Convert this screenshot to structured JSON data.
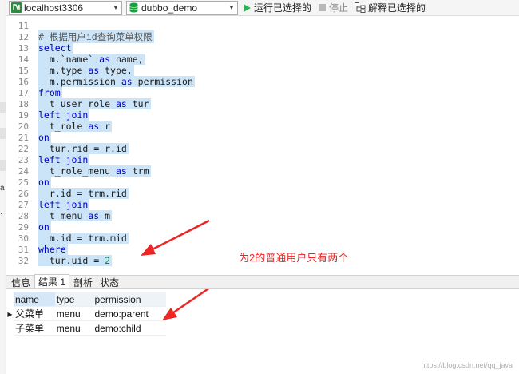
{
  "toolbar": {
    "connection": "localhost3306",
    "database": "dubbo_demo",
    "run_selected": "运行已选择的",
    "stop": "停止",
    "explain_selected": "解释已选择的"
  },
  "left_sliver": {
    "glyph_a": "a",
    "glyph_b": "·"
  },
  "editor": {
    "lines": [
      {
        "n": "11",
        "segs": []
      },
      {
        "n": "12",
        "segs": [
          {
            "t": "# 根据用户id查询菜单权限",
            "c": "cm"
          }
        ]
      },
      {
        "n": "13",
        "segs": [
          {
            "t": "select",
            "c": "kw"
          }
        ]
      },
      {
        "n": "14",
        "segs": [
          {
            "t": "  m.`name` ",
            "c": ""
          },
          {
            "t": "as",
            "c": "kw"
          },
          {
            "t": " name,",
            "c": ""
          }
        ]
      },
      {
        "n": "15",
        "segs": [
          {
            "t": "  m.type ",
            "c": ""
          },
          {
            "t": "as",
            "c": "kw"
          },
          {
            "t": " type,",
            "c": ""
          }
        ]
      },
      {
        "n": "16",
        "segs": [
          {
            "t": "  m.permission ",
            "c": ""
          },
          {
            "t": "as",
            "c": "kw"
          },
          {
            "t": " permission",
            "c": ""
          }
        ]
      },
      {
        "n": "17",
        "segs": [
          {
            "t": "from",
            "c": "kw"
          }
        ]
      },
      {
        "n": "18",
        "segs": [
          {
            "t": "  t_user_role ",
            "c": ""
          },
          {
            "t": "as",
            "c": "kw"
          },
          {
            "t": " tur",
            "c": ""
          }
        ]
      },
      {
        "n": "19",
        "segs": [
          {
            "t": "left join",
            "c": "kw"
          }
        ]
      },
      {
        "n": "20",
        "segs": [
          {
            "t": "  t_role ",
            "c": ""
          },
          {
            "t": "as",
            "c": "kw"
          },
          {
            "t": " r",
            "c": ""
          }
        ]
      },
      {
        "n": "21",
        "segs": [
          {
            "t": "on",
            "c": "kw"
          }
        ]
      },
      {
        "n": "22",
        "segs": [
          {
            "t": "  tur.rid = r.id",
            "c": ""
          }
        ]
      },
      {
        "n": "23",
        "segs": [
          {
            "t": "left join",
            "c": "kw"
          }
        ]
      },
      {
        "n": "24",
        "segs": [
          {
            "t": "  t_role_menu ",
            "c": ""
          },
          {
            "t": "as",
            "c": "kw"
          },
          {
            "t": " trm",
            "c": ""
          }
        ]
      },
      {
        "n": "25",
        "segs": [
          {
            "t": "on",
            "c": "kw"
          }
        ]
      },
      {
        "n": "26",
        "segs": [
          {
            "t": "  r.id = trm.rid",
            "c": ""
          }
        ]
      },
      {
        "n": "27",
        "segs": [
          {
            "t": "left join",
            "c": "kw"
          }
        ]
      },
      {
        "n": "28",
        "segs": [
          {
            "t": "  t_menu ",
            "c": ""
          },
          {
            "t": "as",
            "c": "kw"
          },
          {
            "t": " m",
            "c": ""
          }
        ]
      },
      {
        "n": "29",
        "segs": [
          {
            "t": "on",
            "c": "kw"
          }
        ]
      },
      {
        "n": "30",
        "segs": [
          {
            "t": "  m.id = trm.mid",
            "c": ""
          }
        ]
      },
      {
        "n": "31",
        "segs": [
          {
            "t": "where",
            "c": "kw"
          }
        ]
      },
      {
        "n": "32",
        "segs": [
          {
            "t": "  tur.uid = ",
            "c": ""
          },
          {
            "t": "2",
            "c": "num"
          }
        ]
      }
    ]
  },
  "annotation": "为2的普通用户只有两个",
  "result_tabs": [
    {
      "label": "信息",
      "active": false
    },
    {
      "label": "结果 1",
      "active": true
    },
    {
      "label": "剖析",
      "active": false
    },
    {
      "label": "状态",
      "active": false
    }
  ],
  "result_grid": {
    "columns": [
      "name",
      "type",
      "permission"
    ],
    "rows": [
      {
        "cells": [
          "父菜单",
          "menu",
          "demo:parent"
        ],
        "current": true
      },
      {
        "cells": [
          "子菜单",
          "menu",
          "demo:child"
        ],
        "current": false
      }
    ]
  },
  "watermark": "https://blog.csdn.net/qq_java",
  "colors": {
    "selection": "#cce4f7",
    "keyword": "#0000d0",
    "annotation": "#ef2424"
  }
}
